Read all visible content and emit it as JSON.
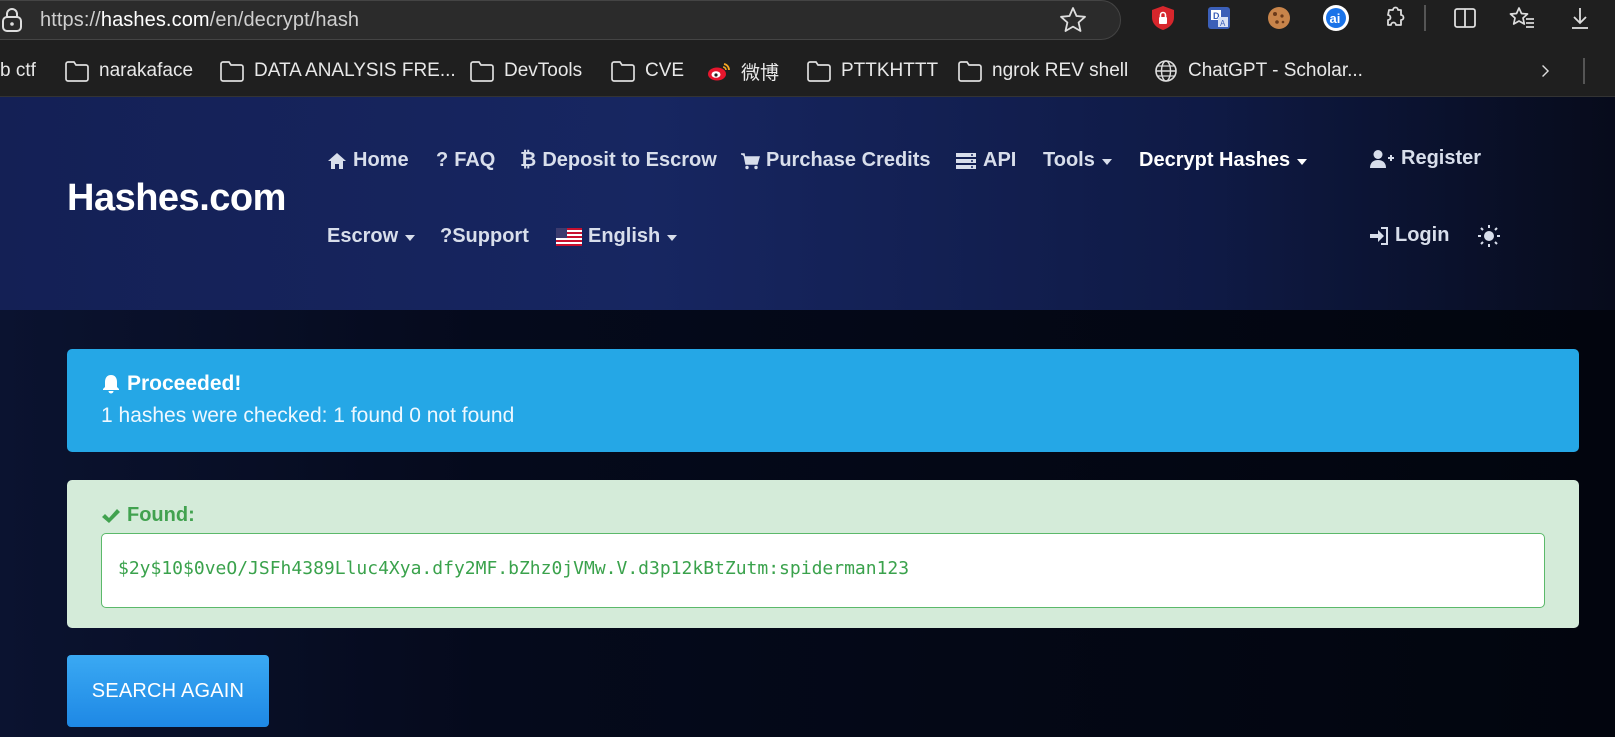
{
  "browser": {
    "url_prefix": "https://",
    "url_domain": "hashes.com",
    "url_path": "/en/decrypt/hash",
    "bookmarks": [
      {
        "label": "b ctf",
        "icon": "none"
      },
      {
        "label": "narakaface",
        "icon": "folder-icon"
      },
      {
        "label": "DATA ANALYSIS FRE...",
        "icon": "folder-icon"
      },
      {
        "label": "DevTools",
        "icon": "folder-icon"
      },
      {
        "label": "CVE",
        "icon": "folder-icon"
      },
      {
        "label": "微博",
        "icon": "weibo-icon"
      },
      {
        "label": "PTTKHTTT",
        "icon": "folder-icon"
      },
      {
        "label": "ngrok REV shell",
        "icon": "folder-icon"
      },
      {
        "label": "ChatGPT - Scholar...",
        "icon": "globe-icon"
      }
    ]
  },
  "site": {
    "logo": "Hashes.com",
    "nav": {
      "home": "Home",
      "faq": "FAQ",
      "deposit": "Deposit to Escrow",
      "purchase": "Purchase Credits",
      "api": "API",
      "tools": "Tools",
      "decrypt": "Decrypt Hashes",
      "escrow": "Escrow",
      "support": "Support",
      "language": "English",
      "register": "Register",
      "login": "Login"
    }
  },
  "alerts": {
    "info_title": "Proceeded!",
    "info_message": "1 hashes were checked: 1 found 0 not found",
    "success_title": "Found:",
    "result": "$2y$10$0veO/JSFh4389Lluc4Xya.dfy2MF.bZhz0jVMw.V.d3p12kBtZutm:spiderman123"
  },
  "actions": {
    "search_again": "SEARCH AGAIN"
  },
  "colors": {
    "info_bg": "#25a7e6",
    "success_bg": "#d4ebd9",
    "success_text": "#41a24f",
    "button": "#1e88e5"
  }
}
